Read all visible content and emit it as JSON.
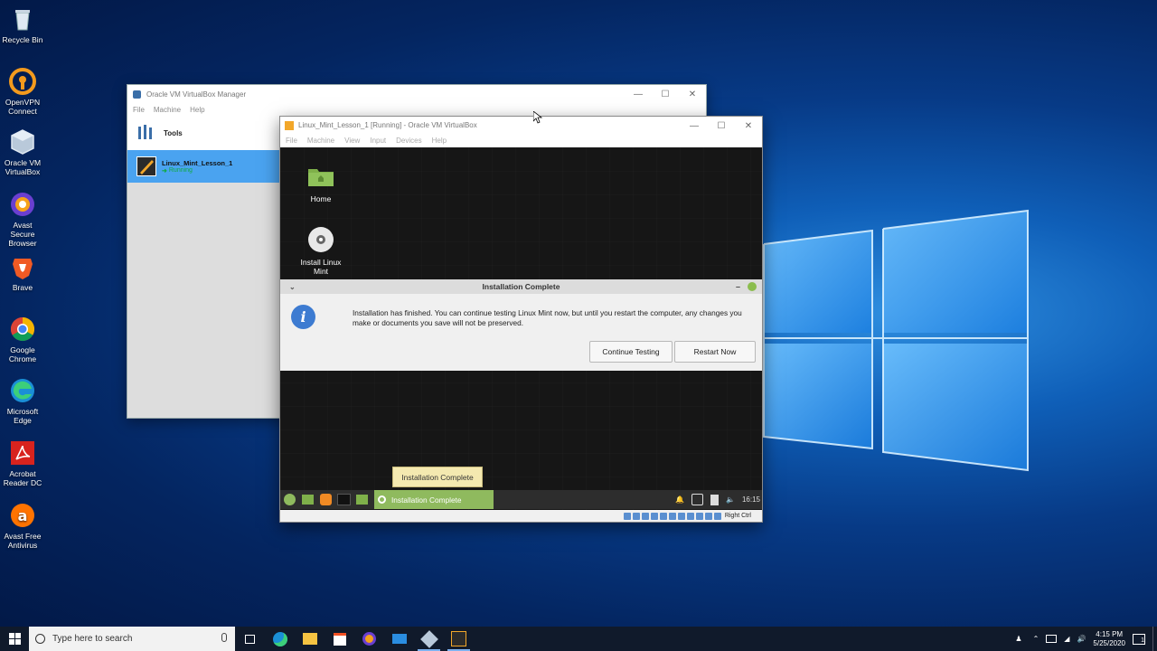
{
  "desktop": {
    "icons": [
      {
        "label": "Recycle Bin",
        "icon": "recycle-bin-icon"
      },
      {
        "label": "OpenVPN\nConnect",
        "icon": "openvpn-icon"
      },
      {
        "label": "Oracle VM\nVirtualBox",
        "icon": "virtualbox-icon"
      },
      {
        "label": "Avast Secure\nBrowser",
        "icon": "avast-browser-icon"
      },
      {
        "label": "Brave",
        "icon": "brave-icon"
      },
      {
        "label": "Google\nChrome",
        "icon": "chrome-icon"
      },
      {
        "label": "Microsoft\nEdge",
        "icon": "edge-icon"
      },
      {
        "label": "Acrobat\nReader DC",
        "icon": "acrobat-icon"
      },
      {
        "label": "Avast Free\nAntivirus",
        "icon": "avast-antivirus-icon"
      }
    ]
  },
  "manager": {
    "title": "Oracle VM VirtualBox Manager",
    "menu": [
      "File",
      "Machine",
      "Help"
    ],
    "tools_label": "Tools",
    "vm_name": "Linux_Mint_Lesson_1",
    "vm_state": "Running"
  },
  "vm_window": {
    "title": "Linux_Mint_Lesson_1 [Running] - Oracle VM VirtualBox",
    "menu": [
      "File",
      "Machine",
      "View",
      "Input",
      "Devices",
      "Help"
    ],
    "desktop_icons": [
      "Home",
      "Install Linux\nMint"
    ],
    "dialog": {
      "title": "Installation Complete",
      "message": "Installation has finished.  You can continue testing Linux Mint now, but until you restart the computer, any changes you make or documents you save will not be preserved.",
      "continue_label": "Continue Testing",
      "restart_label": "Restart Now"
    },
    "tooltip": "Installation Complete",
    "panel": {
      "task_label": "Installation Complete",
      "time": "16:15"
    },
    "host_key": "Right Ctrl"
  },
  "taskbar": {
    "search_placeholder": "Type here to search",
    "time": "4:15 PM",
    "date": "5/25/2020",
    "notification_count": "1"
  }
}
